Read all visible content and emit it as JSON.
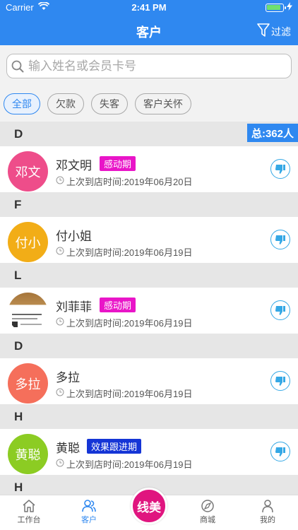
{
  "status": {
    "carrier": "Carrier",
    "time": "2:41 PM"
  },
  "nav": {
    "title": "客户",
    "filter_label": "过滤"
  },
  "search": {
    "placeholder": "输入姓名或会员卡号"
  },
  "chips": [
    {
      "label": "全部",
      "active": true
    },
    {
      "label": "欠款",
      "active": false
    },
    {
      "label": "失客",
      "active": false
    },
    {
      "label": "客户关怀",
      "active": false
    }
  ],
  "total": "总:362人",
  "sections": [
    {
      "letter": "D",
      "name": "邓文明",
      "avatar_text": "邓文",
      "avatar_color": "#ee4d8a",
      "tag": "感动期",
      "tag_color": "#e915c8",
      "visit": "上次到店时间:2019年06月20日"
    },
    {
      "letter": "F",
      "name": "付小姐",
      "avatar_text": "付小",
      "avatar_color": "#f2ad17",
      "tag": "",
      "tag_color": "",
      "visit": "上次到店时间:2019年06月19日"
    },
    {
      "letter": "L",
      "name": "刘菲菲",
      "avatar_text": "",
      "avatar_color": "photo",
      "tag": "感动期",
      "tag_color": "#e915c8",
      "visit": "上次到店时间:2019年06月19日"
    },
    {
      "letter": "D",
      "name": "多拉",
      "avatar_text": "多拉",
      "avatar_color": "#f56f5b",
      "tag": "",
      "tag_color": "",
      "visit": "上次到店时间:2019年06月19日"
    },
    {
      "letter": "H",
      "name": "黄聪",
      "avatar_text": "黄聪",
      "avatar_color": "#8ccc23",
      "tag": "效果跟进期",
      "tag_color": "#1535d6",
      "visit": "上次到店时间:2019年06月19日"
    }
  ],
  "partial_section_letter": "H",
  "tabs": [
    {
      "label": "工作台",
      "icon": "home-icon"
    },
    {
      "label": "客户",
      "icon": "customers-icon"
    },
    {
      "label": "商城",
      "icon": "mall-icon"
    },
    {
      "label": "我的",
      "icon": "profile-icon"
    }
  ],
  "center_button": {
    "label": "线美"
  }
}
